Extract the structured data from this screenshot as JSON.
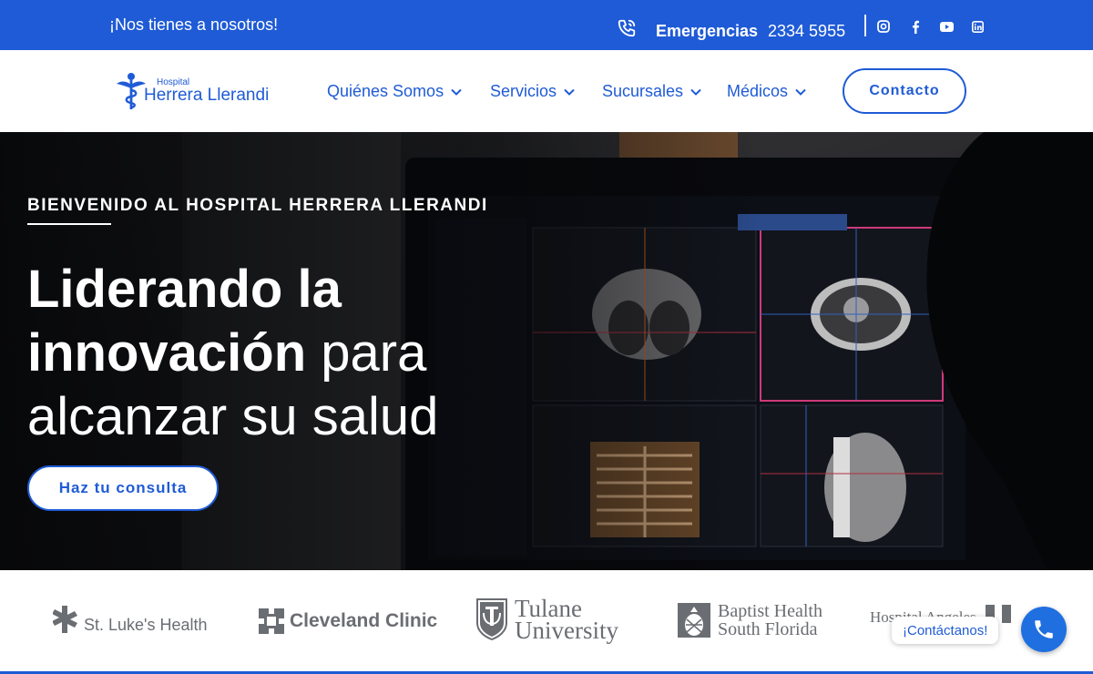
{
  "topbar": {
    "tagline": "¡Nos tienes a nosotros!",
    "emergency_label": "Emergencias",
    "emergency_number": "2334 5955",
    "social_icons": [
      "instagram-icon",
      "facebook-icon",
      "youtube-icon",
      "linkedin-icon"
    ]
  },
  "logo": {
    "small": "Hospital",
    "big": "Herrera Llerandi"
  },
  "nav": {
    "items": [
      {
        "label": "Quiénes Somos"
      },
      {
        "label": "Servicios"
      },
      {
        "label": "Sucursales"
      },
      {
        "label": "Médicos"
      }
    ],
    "contact_label": "Contacto"
  },
  "hero": {
    "eyebrow": "BIENVENIDO AL HOSPITAL HERRERA LLERANDI",
    "headline_line1": "Liderando la",
    "headline_bold2": "innovación",
    "headline_light2": " para",
    "headline_line3": "alcanzar su salud",
    "cta_label": "Haz tu consulta"
  },
  "partners": {
    "st_lukes": "St. Luke's Health",
    "cleveland": "Cleveland Clinic",
    "tulane_1": "Tulane",
    "tulane_2": "University",
    "baptist_1": "Baptist Health",
    "baptist_2": "South Florida",
    "angeles": "Hospital Angeles"
  },
  "floating": {
    "chat_label": "¡Contáctanos!"
  },
  "colors": {
    "brand_blue": "#1f5bd6",
    "partner_gray": "#6a6d72"
  }
}
